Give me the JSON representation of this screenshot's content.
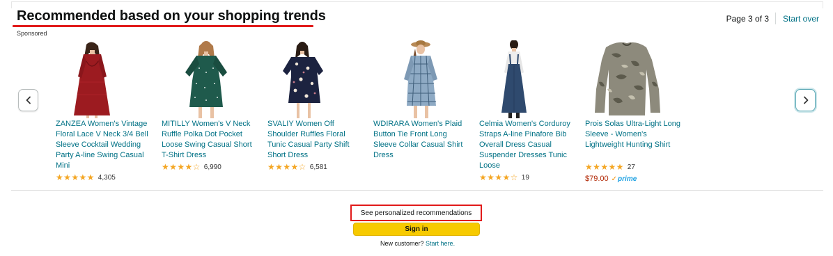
{
  "header": {
    "title": "Recommended based on your shopping trends",
    "sponsored": "Sponsored",
    "page_indicator": "Page 3 of 3",
    "start_over": "Start over"
  },
  "colors": {
    "link": "#007185",
    "star": "#f4a623",
    "price": "#b12704",
    "annotation_red": "#e11a1a",
    "signin_yellow": "#f7ca00"
  },
  "nav": {
    "prev_icon": "chevron-left-icon",
    "next_icon": "chevron-right-icon"
  },
  "products": [
    {
      "title": "ZANZEA Women's Vintage Floral Lace V Neck 3/4 Bell Sleeve Cocktail Wedding Party A-line Swing Casual Mini",
      "rating": 4.5,
      "stars": "★★★★★",
      "reviews": "4,305",
      "image_icon": "red-lace-dress-image"
    },
    {
      "title": "MITILLY Women's V Neck Ruffle Polka Dot Pocket Loose Swing Casual Short T-Shirt Dress",
      "rating": 4.5,
      "stars": "★★★★☆",
      "reviews": "6,990",
      "image_icon": "green-polka-dot-dress-image"
    },
    {
      "title": "SVALIY Women Off Shoulder Ruffles Floral Tunic Casual Party Shift Short Dress",
      "rating": 4.5,
      "stars": "★★★★☆",
      "reviews": "6,581",
      "image_icon": "navy-floral-dress-image"
    },
    {
      "title": "WDIRARA Women's Plaid Button Tie Front Long Sleeve Collar Casual Shirt Dress",
      "rating": null,
      "stars": "",
      "reviews": "",
      "image_icon": "plaid-shirt-dress-image"
    },
    {
      "title": "Celmia Women's Corduroy Straps A-line Pinafore Bib Overall Dress Casual Suspender Dresses Tunic Loose",
      "rating": 3.5,
      "stars": "★★★★☆",
      "reviews": "19",
      "image_icon": "denim-pinafore-dress-image"
    },
    {
      "title": "Prois Solas Ultra-Light Long Sleeve - Women's Lightweight Hunting Shirt",
      "rating": 4.5,
      "stars": "★★★★★",
      "reviews": "27",
      "price": "$79.00",
      "prime": "prime",
      "image_icon": "camo-shirt-image"
    }
  ],
  "footer": {
    "personalized": "See personalized recommendations",
    "signin": "Sign in",
    "new_customer": "New customer?",
    "start_here": "Start here."
  }
}
